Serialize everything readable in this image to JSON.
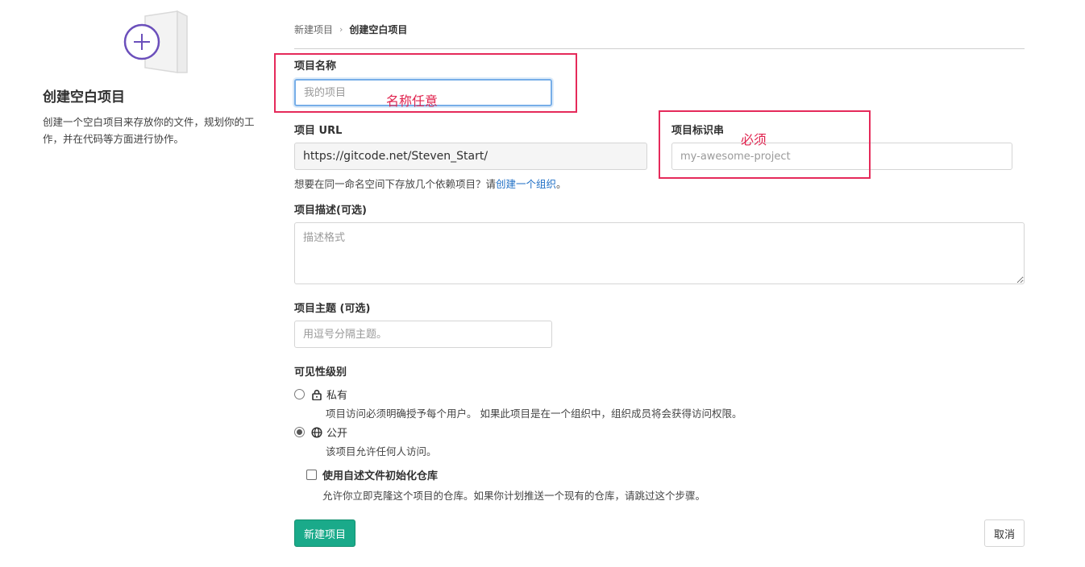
{
  "sidebar": {
    "title": "创建空白项目",
    "description": "创建一个空白项目来存放你的文件，规划你的工作，并在代码等方面进行协作。"
  },
  "breadcrumb": {
    "parent": "新建项目",
    "separator": "›",
    "current": "创建空白项目"
  },
  "form": {
    "name": {
      "label": "项目名称",
      "placeholder": "我的项目",
      "value": ""
    },
    "url": {
      "label": "项目 URL",
      "value": "https://gitcode.net/Steven_Start/"
    },
    "slug": {
      "label": "项目标识串",
      "placeholder": "my-awesome-project",
      "value": ""
    },
    "group_help": {
      "text": "想要在同一命名空间下存放几个依赖项目？请",
      "link": "创建一个组织",
      "suffix": "。"
    },
    "description": {
      "label": "项目描述(可选)",
      "placeholder": "描述格式"
    },
    "topics": {
      "label": "项目主题 (可选)",
      "placeholder": "用逗号分隔主题。"
    },
    "visibility": {
      "label": "可见性级别",
      "options": [
        {
          "title": "私有",
          "icon": "lock-icon",
          "desc": "项目访问必须明确授予每个用户。 如果此项目是在一个组织中，组织成员将会获得访问权限。",
          "checked": false
        },
        {
          "title": "公开",
          "icon": "globe-icon",
          "desc": "该项目允许任何人访问。",
          "checked": true
        }
      ]
    },
    "readme": {
      "title": "使用自述文件初始化仓库",
      "desc": "允许你立即克隆这个项目的仓库。如果你计划推送一个现有的仓库，请跳过这个步骤。",
      "checked": false
    },
    "submit_label": "新建项目",
    "cancel_label": "取消"
  },
  "annotations": {
    "name_note": "名称任意",
    "slug_note": "必须"
  },
  "colors": {
    "primary_button": "#1aaa8a",
    "annotation_red": "#e52a5a",
    "link": "#1f6fc5",
    "illustration_purple": "#6b4fbb"
  }
}
